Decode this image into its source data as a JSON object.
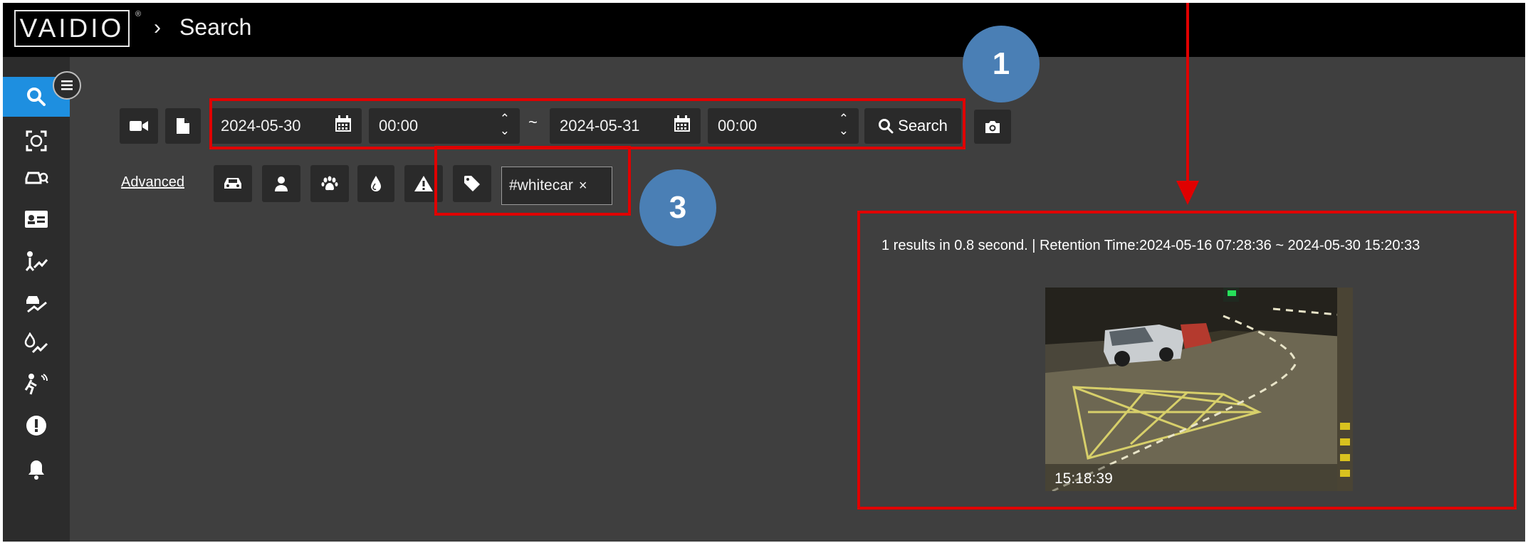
{
  "header": {
    "logo": "VAIDIO",
    "registered": "®",
    "chevron": "›",
    "page_title": "Search"
  },
  "sidebar": {
    "toggle_icon": "hamburger-icon",
    "items": [
      {
        "icon": "search-icon",
        "glyph": "⚲",
        "active": true
      },
      {
        "icon": "face-recognition-icon",
        "glyph": "☺"
      },
      {
        "icon": "vehicle-search-icon",
        "glyph": "⛍"
      },
      {
        "icon": "id-card-icon",
        "glyph": "▤"
      },
      {
        "icon": "person-trend-icon",
        "glyph": "⤴"
      },
      {
        "icon": "vehicle-trend-icon",
        "glyph": "⤴"
      },
      {
        "icon": "fire-trend-icon",
        "glyph": "⤴"
      },
      {
        "icon": "intrusion-icon",
        "glyph": "✱"
      },
      {
        "icon": "alert-icon",
        "glyph": "❗"
      },
      {
        "icon": "bell-icon",
        "glyph": "🔔"
      }
    ]
  },
  "search": {
    "start_date": "2024-05-30",
    "start_time": "00:00",
    "separator": "~",
    "end_date": "2024-05-31",
    "end_time": "00:00",
    "search_label": "Search",
    "advanced_label": "Advanced",
    "tag_value": "#whitecar",
    "tag_remove": "×"
  },
  "annotations": {
    "badge_1": "1",
    "badge_3": "3"
  },
  "results": {
    "summary": "1 results in 0.8 second. | Retention Time:2024-05-16 07:28:36 ~ 2024-05-30 15:20:33",
    "thumb_time": "15:18:39"
  },
  "colors": {
    "accent": "#1e8fe0",
    "highlight": "#e00000",
    "badge": "#4a7fb5"
  }
}
